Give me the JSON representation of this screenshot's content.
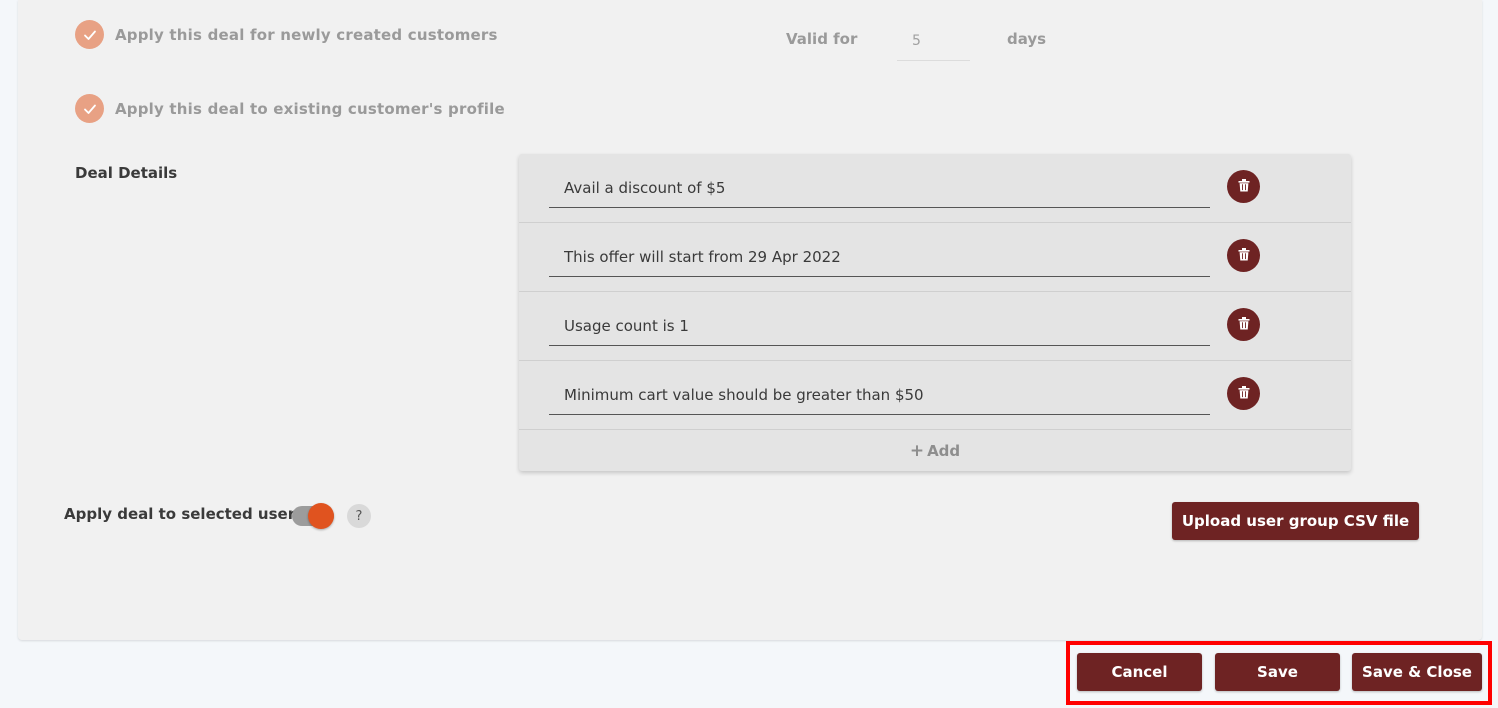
{
  "options": {
    "new_customers_label": "Apply this deal for newly created customers",
    "existing_customers_label": "Apply this deal to existing customer's profile",
    "valid_for_label": "Valid for",
    "valid_for_value": "5",
    "days_label": "days"
  },
  "deal_details": {
    "title": "Deal Details",
    "items": [
      "Avail a discount of $5",
      "This offer will start from 29 Apr 2022",
      "Usage count is 1",
      "Minimum cart value should be greater than $50"
    ],
    "add_label": "Add"
  },
  "selected_users": {
    "label": "Apply deal to selected users",
    "toggle_on": true,
    "help": "?",
    "upload_label": "Upload user group CSV file"
  },
  "footer": {
    "cancel_label": "Cancel",
    "save_label": "Save",
    "save_close_label": "Save & Close"
  },
  "colors": {
    "primary": "#6e2323",
    "check": "#e8a184",
    "toggle_knob": "#e0531f",
    "highlight": "#ff0000"
  }
}
